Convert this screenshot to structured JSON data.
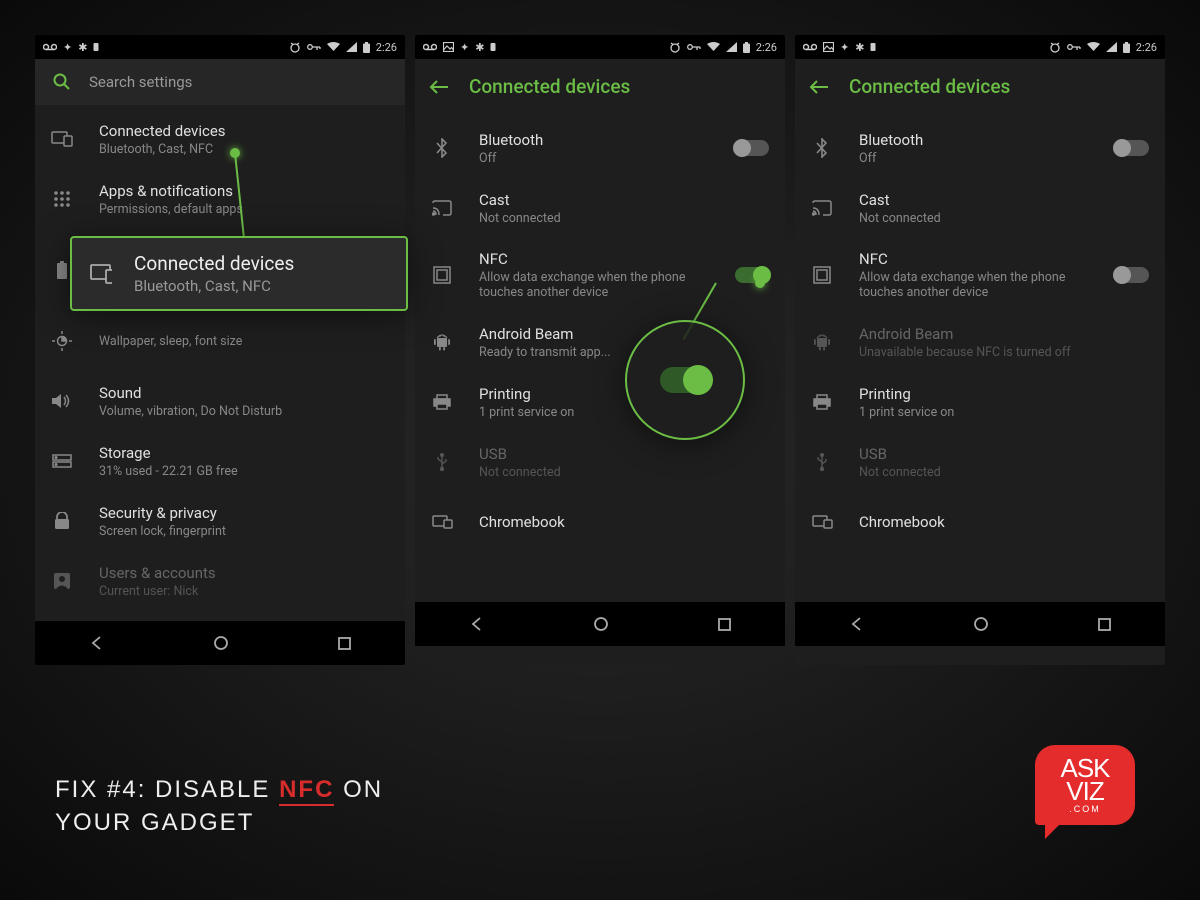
{
  "status": {
    "time": "2:26"
  },
  "p1": {
    "search_placeholder": "Search settings",
    "items": [
      {
        "title": "Connected devices",
        "sub": "Bluetooth, Cast, NFC"
      },
      {
        "title": "Apps & notifications",
        "sub": "Permissions, default apps"
      },
      {
        "title": "Battery",
        "sub": ""
      },
      {
        "title": "Display",
        "sub": "Wallpaper, sleep, font size"
      },
      {
        "title": "Sound",
        "sub": "Volume, vibration, Do Not Disturb"
      },
      {
        "title": "Storage",
        "sub": "31% used - 22.21 GB free"
      },
      {
        "title": "Security & privacy",
        "sub": "Screen lock, fingerprint"
      },
      {
        "title": "Users & accounts",
        "sub": "Current user: Nick"
      }
    ],
    "callout": {
      "title": "Connected devices",
      "sub": "Bluetooth, Cast, NFC"
    }
  },
  "p2": {
    "title": "Connected devices",
    "items": [
      {
        "title": "Bluetooth",
        "sub": "Off"
      },
      {
        "title": "Cast",
        "sub": "Not connected"
      },
      {
        "title": "NFC",
        "sub": "Allow data exchange when the phone touches another device"
      },
      {
        "title": "Android Beam",
        "sub": "Ready to transmit app..."
      },
      {
        "title": "Printing",
        "sub": "1 print service on"
      },
      {
        "title": "USB",
        "sub": "Not connected"
      },
      {
        "title": "Chromebook",
        "sub": ""
      }
    ]
  },
  "p3": {
    "title": "Connected devices",
    "items": [
      {
        "title": "Bluetooth",
        "sub": "Off"
      },
      {
        "title": "Cast",
        "sub": "Not connected"
      },
      {
        "title": "NFC",
        "sub": "Allow data exchange when the phone touches another device"
      },
      {
        "title": "Android Beam",
        "sub": "Unavailable because NFC is turned off"
      },
      {
        "title": "Printing",
        "sub": "1 print service on"
      },
      {
        "title": "USB",
        "sub": "Not connected"
      },
      {
        "title": "Chromebook",
        "sub": ""
      }
    ]
  },
  "caption": {
    "line1a": "FIX #4: DISABLE ",
    "hl": "NFC",
    "line1b": " ON",
    "line2": "YOUR GADGET"
  },
  "logo": {
    "line1": "ASK",
    "line2": "VIZ",
    "sub": ".COM"
  }
}
